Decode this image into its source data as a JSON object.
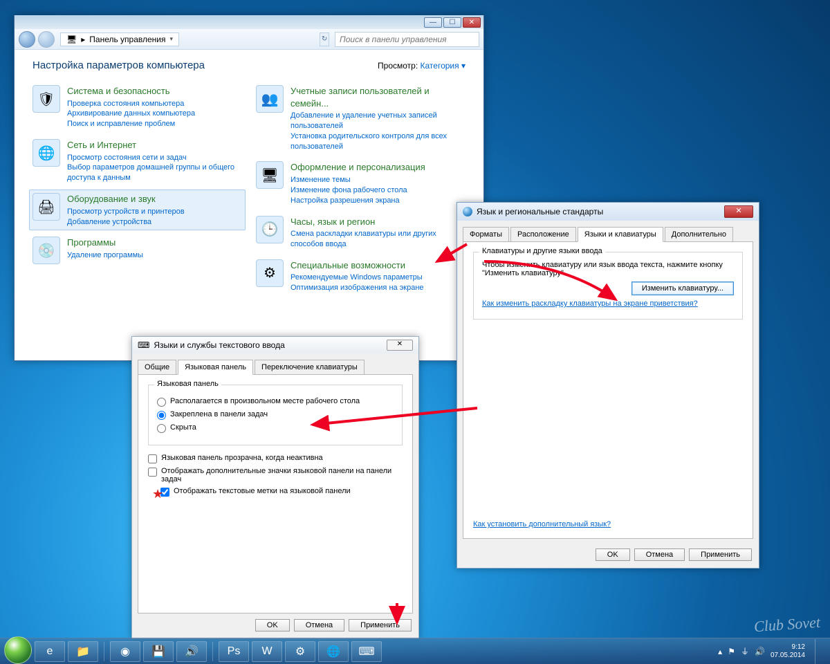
{
  "controlPanel": {
    "breadcrumb": "Панель управления",
    "searchPlaceholder": "Поиск в панели управления",
    "heading": "Настройка параметров компьютера",
    "viewLabel": "Просмотр:",
    "viewValue": "Категория",
    "categories": {
      "sys": {
        "title": "Система и безопасность",
        "l1": "Проверка состояния компьютера",
        "l2": "Архивирование данных компьютера",
        "l3": "Поиск и исправление проблем"
      },
      "net": {
        "title": "Сеть и Интернет",
        "l1": "Просмотр состояния сети и задач",
        "l2": "Выбор параметров домашней группы и общего доступа к данным"
      },
      "hw": {
        "title": "Оборудование и звук",
        "l1": "Просмотр устройств и принтеров",
        "l2": "Добавление устройства"
      },
      "prog": {
        "title": "Программы",
        "l1": "Удаление программы"
      },
      "user": {
        "title": "Учетные записи пользователей и семейн...",
        "l1": "Добавление и удаление учетных записей пользователей",
        "l2": "Установка родительского контроля для всех пользователей"
      },
      "app": {
        "title": "Оформление и персонализация",
        "l1": "Изменение темы",
        "l2": "Изменение фона рабочего стола",
        "l3": "Настройка разрешения экрана"
      },
      "clk": {
        "title": "Часы, язык и регион",
        "l1": "Смена раскладки клавиатуры или других способов ввода"
      },
      "ease": {
        "title": "Специальные возможности",
        "l1": "Рекомендуемые Windows параметры",
        "l2": "Оптимизация изображения на экране"
      }
    }
  },
  "regionDialog": {
    "title": "Язык и региональные стандарты",
    "tabs": {
      "t1": "Форматы",
      "t2": "Расположение",
      "t3": "Языки и клавиатуры",
      "t4": "Дополнительно"
    },
    "groupTitle": "Клавиатуры и другие языки ввода",
    "groupText": "Чтобы изменить клавиатуру или язык ввода текста, нажмите кнопку \"Изменить клавиатуру\".",
    "changeBtn": "Изменить клавиатуру...",
    "link1": "Как изменить раскладку клавиатуры на экране приветствия?",
    "link2": "Как установить дополнительный язык?",
    "ok": "OK",
    "cancel": "Отмена",
    "apply": "Применить"
  },
  "textServices": {
    "title": "Языки и службы текстового ввода",
    "tabs": {
      "t1": "Общие",
      "t2": "Языковая панель",
      "t3": "Переключение клавиатуры"
    },
    "groupTitle": "Языковая панель",
    "r1": "Располагается в произвольном месте рабочего стола",
    "r2": "Закреплена в панели задач",
    "r3": "Скрыта",
    "c1": "Языковая панель прозрачна, когда неактивна",
    "c2": "Отображать дополнительные значки языковой панели на панели задач",
    "c3": "Отображать текстовые метки на языковой панели",
    "ok": "OK",
    "cancel": "Отмена",
    "apply": "Применить"
  },
  "taskbar": {
    "time": "9:12",
    "date": "07.05.2014"
  },
  "watermark": "Club Sovet"
}
